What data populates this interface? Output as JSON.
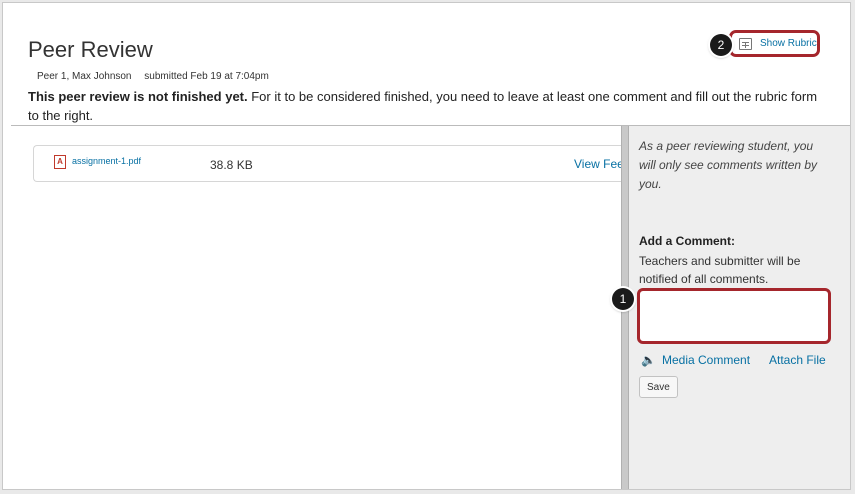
{
  "header": {
    "title": "Peer Review",
    "reviewer": "Peer 1, Max Johnson",
    "submitted": "submitted Feb 19 at 7:04pm",
    "notice_bold": "This peer review is not finished yet.",
    "notice_rest": " For it to be considered finished, you need to leave at least one comment and fill out the rubric form to the right.",
    "show_rubric_label": "Show Rubric"
  },
  "callouts": {
    "comment_badge": "1",
    "rubric_badge": "2"
  },
  "file": {
    "name": "assignment-1.pdf",
    "size": "38.8 KB",
    "view_feedback_label": "View Feedback",
    "pdf_glyph": "A"
  },
  "sidebar": {
    "note": "As a peer reviewing student, you will only see comments written by you.",
    "comment_heading": "Add a Comment:",
    "comment_help": "Teachers and submitter will be notified of all comments.",
    "comment_value": "",
    "media_comment_label": "Media Comment",
    "attach_file_label": "Attach File",
    "save_label": "Save",
    "speaker_glyph": "🔈"
  },
  "colors": {
    "link": "#0770a3",
    "highlight": "#a5262c"
  }
}
